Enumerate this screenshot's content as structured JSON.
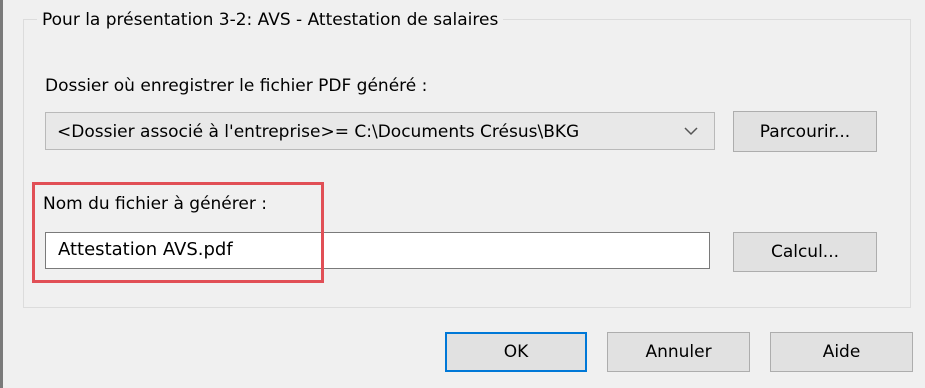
{
  "group": {
    "title": "Pour la présentation 3-2: AVS - Attestation de salaires"
  },
  "folder": {
    "label": "Dossier où enregistrer le fichier PDF généré :",
    "selected_value": "<Dossier associé à l'entreprise>= C:\\Documents Crésus\\BKG",
    "browse_label": "Parcourir..."
  },
  "filename": {
    "label": "Nom du fichier à générer :",
    "value": "Attestation AVS.pdf",
    "calc_label": "Calcul..."
  },
  "footer": {
    "ok_label": "OK",
    "cancel_label": "Annuler",
    "help_label": "Aide"
  },
  "colors": {
    "highlight": "#e14f56",
    "default_button_border": "#0078d7"
  }
}
